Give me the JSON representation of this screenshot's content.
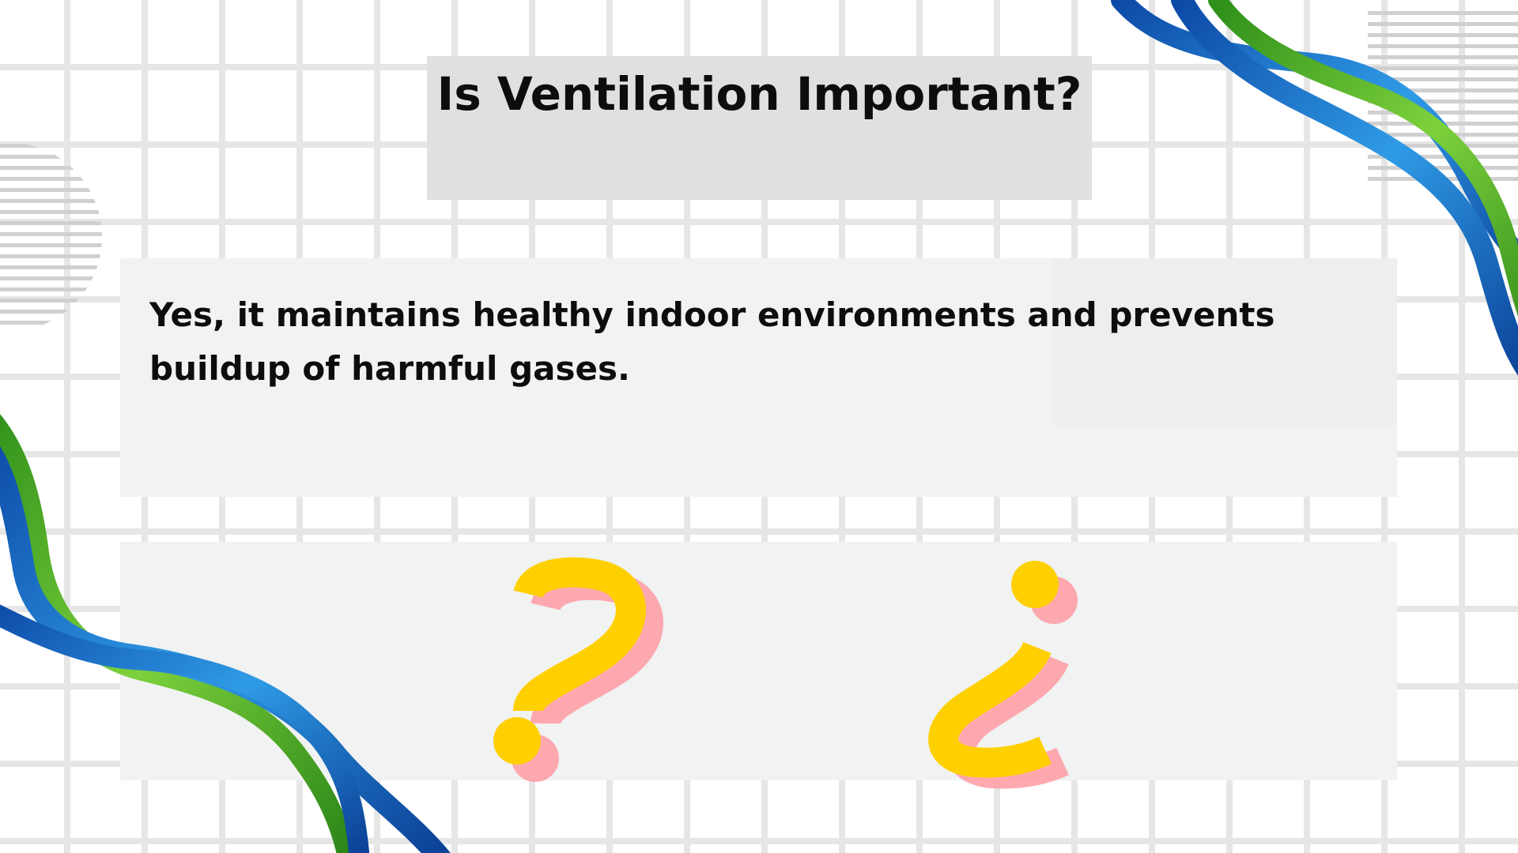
{
  "slide": {
    "title": "Is Ventilation Important?",
    "answer": "Yes, it maintains healthy indoor environments and prevents buildup of harmful gases."
  },
  "colors": {
    "background": "#ffffff",
    "grid_lines": "#e6e6e6",
    "title_box": "#dfe0e0",
    "content_box": "#f1f2f2",
    "text": "#0d0d0d",
    "question_mark_yellow": "#ffd000",
    "question_mark_shadow": "#ff9aa2",
    "ribbon_blue": "#1a73c8",
    "ribbon_green": "#4cae2a"
  },
  "icons": [
    "question-mark-icon",
    "inverted-question-mark-icon",
    "striped-circle-decoration",
    "striped-square-decoration",
    "ribbon-decoration"
  ]
}
